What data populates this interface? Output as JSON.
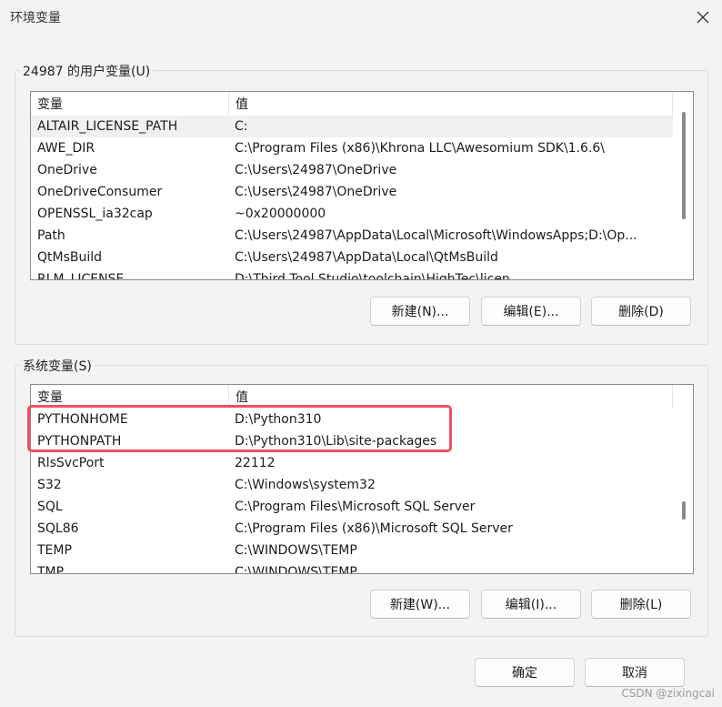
{
  "window": {
    "title": "环境变量",
    "close_icon": "close-icon"
  },
  "user_vars": {
    "group_label": "24987 的用户变量(U)",
    "col_name": "变量",
    "col_value": "值",
    "rows": [
      {
        "name": "ALTAIR_LICENSE_PATH",
        "value": "C:"
      },
      {
        "name": "AWE_DIR",
        "value": "C:\\Program Files (x86)\\Khrona LLC\\Awesomium SDK\\1.6.6\\"
      },
      {
        "name": "OneDrive",
        "value": "C:\\Users\\24987\\OneDrive"
      },
      {
        "name": "OneDriveConsumer",
        "value": "C:\\Users\\24987\\OneDrive"
      },
      {
        "name": "OPENSSL_ia32cap",
        "value": "~0x20000000"
      },
      {
        "name": "Path",
        "value": "C:\\Users\\24987\\AppData\\Local\\Microsoft\\WindowsApps;D:\\Op..."
      },
      {
        "name": "QtMsBuild",
        "value": "C:\\Users\\24987\\AppData\\Local\\QtMsBuild"
      },
      {
        "name": "RLM_LICENSE",
        "value": "D:\\Third Tool Studio\\toolchain\\HighTec\\licen"
      }
    ],
    "buttons": {
      "new": "新建(N)...",
      "edit": "编辑(E)...",
      "delete": "删除(D)"
    }
  },
  "system_vars": {
    "group_label": "系统变量(S)",
    "col_name": "变量",
    "col_value": "值",
    "rows": [
      {
        "name": "PYTHONHOME",
        "value": "D:\\Python310"
      },
      {
        "name": "PYTHONPATH",
        "value": "D:\\Python310\\Lib\\site-packages"
      },
      {
        "name": "RlsSvcPort",
        "value": "22112"
      },
      {
        "name": "S32",
        "value": "C:\\Windows\\system32"
      },
      {
        "name": "SQL",
        "value": "C:\\Program Files\\Microsoft SQL Server"
      },
      {
        "name": "SQL86",
        "value": "C:\\Program Files (x86)\\Microsoft SQL Server"
      },
      {
        "name": "TEMP",
        "value": "C:\\WINDOWS\\TEMP"
      },
      {
        "name": "TMP",
        "value": "C:\\WINDOWS\\TEMP"
      }
    ],
    "buttons": {
      "new": "新建(W)...",
      "edit": "编辑(I)...",
      "delete": "删除(L)"
    }
  },
  "footer": {
    "ok": "确定",
    "cancel": "取消"
  },
  "watermark": "CSDN @zixingcai",
  "colors": {
    "highlight": "#ea5160",
    "selection": "#f0f0f0"
  }
}
